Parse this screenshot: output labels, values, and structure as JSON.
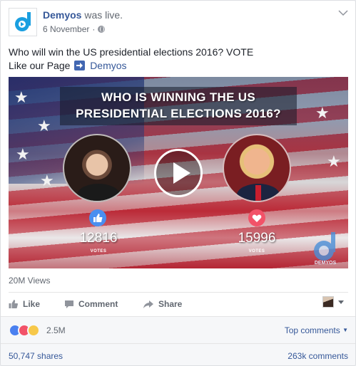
{
  "post": {
    "page_name": "Demyos",
    "live_text": "was live.",
    "date": "6 November",
    "separator": "·",
    "text_line1": "Who will win the US presidential elections 2016? VOTE",
    "text_line2_prefix": "Like our Page",
    "text_line2_link": "Demyos"
  },
  "video": {
    "title_line1": "WHO IS WINNING THE US",
    "title_line2": "PRESIDENTIAL ELECTIONS 2016?",
    "left_votes": "12816",
    "right_votes": "15996",
    "votes_label": "VOTES",
    "watermark": "DEMYOS"
  },
  "views": "20M Views",
  "actions": {
    "like": "Like",
    "comment": "Comment",
    "share": "Share"
  },
  "reactions": {
    "count": "2.5M",
    "top_comments": "Top comments"
  },
  "stats": {
    "shares": "50,747 shares",
    "comments": "263k comments"
  },
  "colors": {
    "link": "#365899",
    "brand_blue": "#4267b2",
    "like_blue": "#4a80f0",
    "love_red": "#f25268",
    "haha_yellow": "#f7c84a"
  }
}
